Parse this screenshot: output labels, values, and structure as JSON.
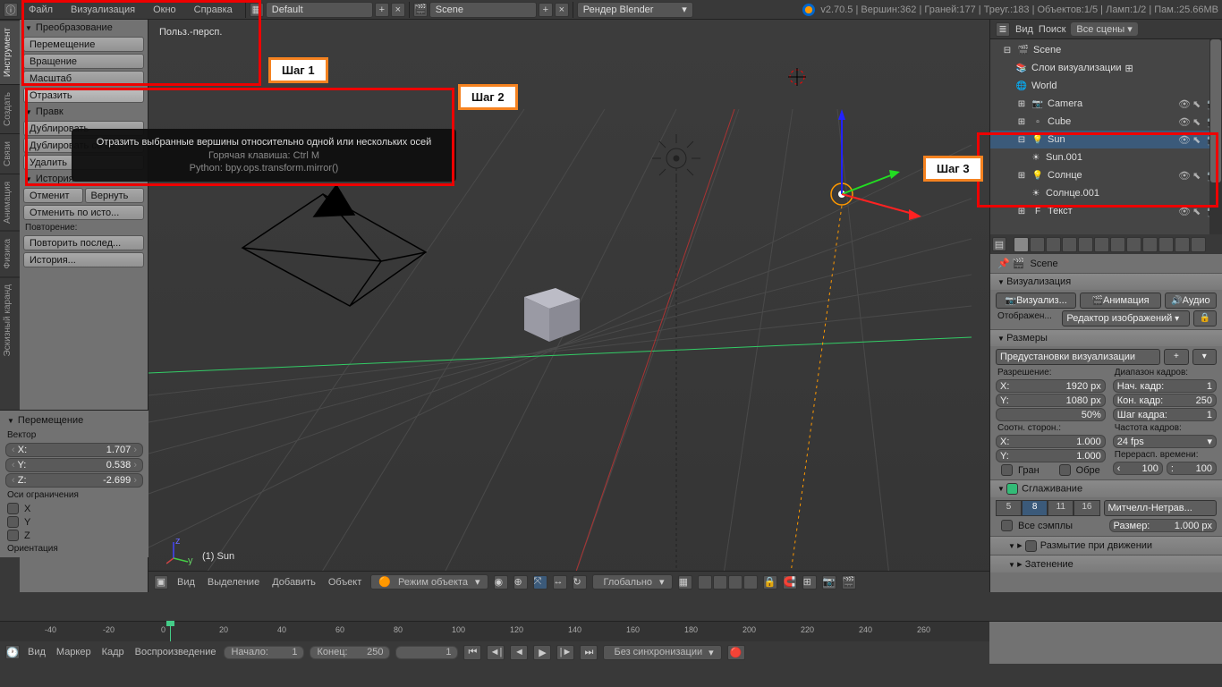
{
  "topbar": {
    "menus": [
      "Файл",
      "Визуализация",
      "Окно",
      "Справка"
    ],
    "layout": "Default",
    "scene": "Scene",
    "engine": "Рендер Blender",
    "status": "v2.70.5 | Вершин:362 | Граней:177 | Треуг.:183 | Объектов:1/5 | Ламп:1/2 | Пам.:25.66MB"
  },
  "left_tabs": [
    "Инструмент",
    "Создать",
    "Связи",
    "Анимация",
    "Физика",
    "Эскизный каранд"
  ],
  "tool_panel": {
    "transform_h": "Преобразование",
    "translate": "Перемещение",
    "rotate": "Вращение",
    "scale": "Масштаб",
    "mirror": "Отразить",
    "edit_h": "Правк",
    "dup": "Дублировать",
    "dup_link": "Дублировать со св...",
    "delete": "Удалить",
    "history_h": "История",
    "undo": "Отменит",
    "redo": "Вернуть",
    "undo_hist": "Отменить по исто...",
    "repeat_label": "Повторение:",
    "repeat_last": "Повторить послед...",
    "history": "История..."
  },
  "tooltip": {
    "l1": "Отразить выбранные вершины относительно одной или нескольких осей",
    "l2": "Горячая клавиша: Ctrl M",
    "l3": "Python: bpy.ops.transform.mirror()"
  },
  "n_panel": {
    "title": "Перемещение",
    "vec_label": "Вектор",
    "x": "1.707",
    "y": "0.538",
    "z": "-2.699",
    "axis_label": "Оси ограничения",
    "ax": [
      "X",
      "Y",
      "Z"
    ],
    "orient": "Ориентация"
  },
  "viewport": {
    "persp": "Польз.-персп.",
    "obj": "(1) Sun",
    "menus": [
      "Вид",
      "Выделение",
      "Добавить",
      "Объект"
    ],
    "mode": "Режим объекта",
    "orient": "Глобально"
  },
  "outliner": {
    "menus": [
      "Вид",
      "Поиск"
    ],
    "filter": "Все сцены",
    "nodes": [
      {
        "indent": 0,
        "icon": "🎬",
        "label": "Scene",
        "exp": "−"
      },
      {
        "indent": 1,
        "icon": "📚",
        "label": "Слои визуализации",
        "extra": "⊞"
      },
      {
        "indent": 1,
        "icon": "🌐",
        "label": "World"
      },
      {
        "indent": 1,
        "icon": "📷",
        "label": "Camera",
        "exp": "+",
        "ricons": true
      },
      {
        "indent": 1,
        "icon": "▫",
        "label": "Cube",
        "exp": "+",
        "ricons": true
      },
      {
        "indent": 1,
        "icon": "💡",
        "label": "Sun",
        "exp": "−",
        "ricons": true,
        "sel": true
      },
      {
        "indent": 2,
        "icon": "☀",
        "label": "Sun.001"
      },
      {
        "indent": 1,
        "icon": "💡",
        "label": "Солнце",
        "exp": "+",
        "ricons": true
      },
      {
        "indent": 2,
        "icon": "☀",
        "label": "Солнце.001"
      },
      {
        "indent": 1,
        "icon": "F",
        "label": "Текст",
        "exp": "+",
        "ricons": true
      }
    ]
  },
  "props": {
    "crumb": "Scene",
    "render_h": "Визуализация",
    "btn_render": "Визуализ...",
    "btn_anim": "Анимация",
    "btn_audio": "Аудио",
    "display_label": "Отображен...",
    "display_val": "Редактор изображений",
    "dims_h": "Размеры",
    "presets": "Предустановки визуализации",
    "res_label": "Разрешение:",
    "res_x": "1920 px",
    "res_y": "1080 px",
    "res_pct": "50%",
    "frange_label": "Диапазон кадров:",
    "fstart_l": "Нач. кадр:",
    "fstart": "1",
    "fend_l": "Кон. кадр:",
    "fend": "250",
    "fstep_l": "Шаг кадра:",
    "fstep": "1",
    "aspect_label": "Соотн. сторон.:",
    "asp_x": "1.000",
    "asp_y": "1.000",
    "fps_label": "Частота кадров:",
    "fps": "24 fps",
    "remap_label": "Перерасп. времени:",
    "remap_a": "100",
    "remap_b": "100",
    "border": "Гран",
    "crop": "Обре",
    "aa_h": "Сглаживание",
    "aa_samples": [
      "5",
      "8",
      "11",
      "16"
    ],
    "aa_sel": "8",
    "aa_filter": "Митчелл-Нетрав...",
    "full_sample": "Все сэмплы",
    "pixel_size_l": "Размер:",
    "pixel_size": "1.000 px",
    "mblur_h": "Размытие при движении",
    "shading_h": "Затенение"
  },
  "timeline": {
    "menus": [
      "Вид",
      "Маркер",
      "Кадр",
      "Воспроизведение"
    ],
    "start_l": "Начало:",
    "start": "1",
    "end_l": "Конец:",
    "end": "250",
    "cur": "1",
    "sync": "Без синхронизации",
    "ticks": [
      -40,
      -20,
      0,
      20,
      40,
      60,
      80,
      100,
      120,
      140,
      160,
      180,
      200,
      220,
      240,
      260
    ]
  },
  "annotations": {
    "s1": "Шаг 1",
    "s2": "Шаг 2",
    "s3": "Шаг 3"
  }
}
